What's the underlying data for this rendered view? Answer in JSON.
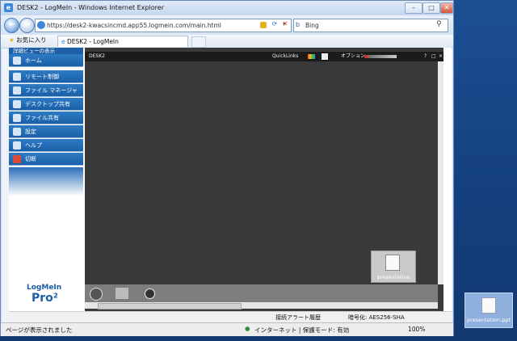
{
  "window": {
    "title": "DESK2 - LogMeIn - Windows Internet Explorer",
    "controls": [
      "–",
      "□",
      "✕"
    ]
  },
  "navbar": {
    "back": "←",
    "forward": "→",
    "url": "https://desk2-kwacsincmd.app55.logmein.com/main.html",
    "search_text": "Bing"
  },
  "favorites_bar": {
    "favorites_label": "お気に入り",
    "active_tab": "DESK2 - LogMeIn"
  },
  "sidebar": {
    "header": "詳細ビューの表示",
    "items": [
      {
        "label": "ホーム"
      },
      {
        "label": "リモート制御"
      },
      {
        "label": "ファイル マネージャ"
      },
      {
        "label": "デスクトップ共有"
      },
      {
        "label": "ファイル共有"
      },
      {
        "label": "設定"
      },
      {
        "label": "ヘルプ"
      },
      {
        "label": "切断"
      }
    ],
    "logo_text": "LogMeIn",
    "logo_pro": "Pro²"
  },
  "remote": {
    "computer_name": "DESK2",
    "quicklinks_label": "QuickLinks",
    "options_label": "オプション",
    "desktop_icon_label": "presentation",
    "toolbar_icons": [
      "?",
      "□",
      "×"
    ]
  },
  "statusbar_top": {
    "alert_history": "接続アラート履歴",
    "encryption": "暗号化: AES256-SHA"
  },
  "statusbar": {
    "page_status": "ページが表示されました",
    "zone": "インターネット | 保護モード: 有効",
    "zoom": "100%"
  },
  "desktop": {
    "outer_icon_label": "presentation.ppt"
  }
}
